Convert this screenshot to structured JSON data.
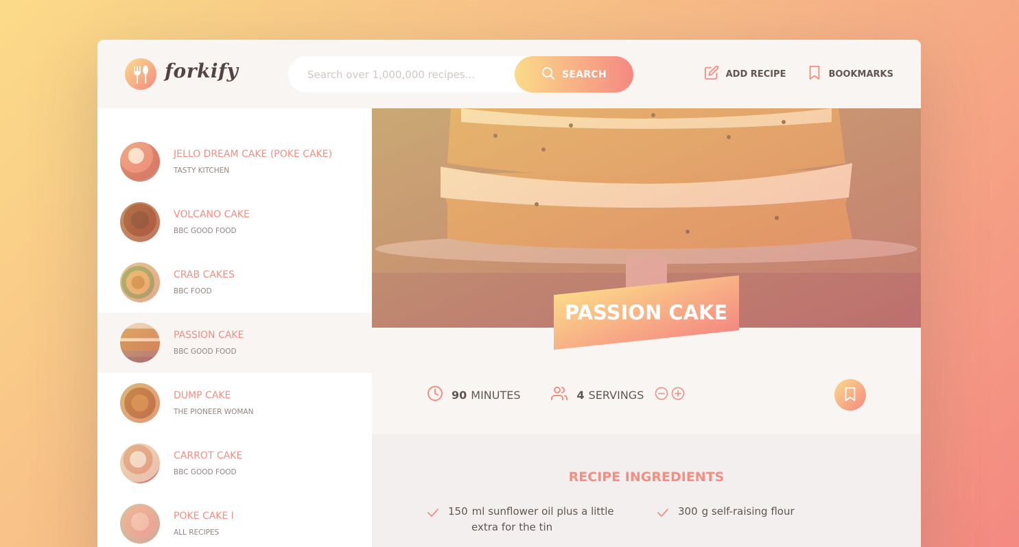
{
  "app": {
    "name": "forkify"
  },
  "search": {
    "placeholder": "Search over 1,000,000 recipes...",
    "value": "",
    "button_label": "SEARCH"
  },
  "nav": {
    "add_recipe_label": "ADD RECIPE",
    "bookmarks_label": "BOOKMARKS"
  },
  "results": [
    {
      "title": "JELLO DREAM CAKE (POKE CAKE)",
      "publisher": "TASTY KITCHEN",
      "active": false
    },
    {
      "title": "VOLCANO CAKE",
      "publisher": "BBC GOOD FOOD",
      "active": false
    },
    {
      "title": "CRAB CAKES",
      "publisher": "BBC FOOD",
      "active": false
    },
    {
      "title": "PASSION CAKE",
      "publisher": "BBC GOOD FOOD",
      "active": true
    },
    {
      "title": "DUMP CAKE",
      "publisher": "THE PIONEER WOMAN",
      "active": false
    },
    {
      "title": "CARROT CAKE",
      "publisher": "BBC GOOD FOOD",
      "active": false
    },
    {
      "title": "POKE CAKE I",
      "publisher": "ALL RECIPES",
      "active": false
    }
  ],
  "recipe": {
    "title": "PASSION CAKE",
    "cooking_time": "90",
    "cooking_time_unit": "MINUTES",
    "servings": "4",
    "servings_unit": "SERVINGS",
    "ingredients_heading": "RECIPE INGREDIENTS",
    "ingredients": [
      {
        "quantity": "150",
        "text": "ml sunflower oil plus a little",
        "text2": "extra for the tin"
      },
      {
        "quantity": "300",
        "text": "g self-raising flour",
        "text2": ""
      }
    ]
  },
  "colors": {
    "accent": "#f38e82",
    "gradient_start": "#fbdb89",
    "gradient_end": "#f48982",
    "text": "#615551"
  },
  "icons": {
    "logo": "fork-knife-icon",
    "search": "search-icon",
    "add_recipe": "edit-icon",
    "bookmarks": "bookmark-icon",
    "time": "clock-icon",
    "servings": "users-icon",
    "decrease": "minus-circle-icon",
    "increase": "plus-circle-icon",
    "check": "check-icon"
  }
}
